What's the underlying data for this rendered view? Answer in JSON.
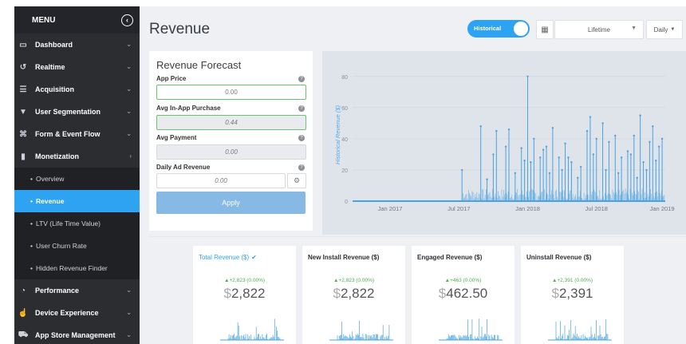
{
  "sidebar": {
    "menu_label": "MENU",
    "items": [
      {
        "label": "Dashboard",
        "icon": "monitor-icon"
      },
      {
        "label": "Realtime",
        "icon": "history-icon"
      },
      {
        "label": "Acquisition",
        "icon": "list-icon"
      },
      {
        "label": "User Segmentation",
        "icon": "funnel-icon"
      },
      {
        "label": "Form & Event Flow",
        "icon": "flow-icon"
      },
      {
        "label": "Monetization",
        "icon": "bar-chart-icon"
      }
    ],
    "sub_items": [
      {
        "label": "Overview"
      },
      {
        "label": "Revenue"
      },
      {
        "label": "LTV (Life Time Value)"
      },
      {
        "label": "User Churn Rate"
      },
      {
        "label": "Hidden Revenue Finder"
      }
    ],
    "bottom_items": [
      {
        "label": "Performance",
        "icon": "gauge-icon"
      },
      {
        "label": "Device Experience",
        "icon": "hand-icon"
      },
      {
        "label": "App Store Management",
        "icon": "cart-icon"
      }
    ]
  },
  "header": {
    "title": "Revenue",
    "toggle_label": "Historical",
    "range": "Lifetime",
    "period": "Daily"
  },
  "forecast": {
    "title": "Revenue Forecast",
    "fields": [
      {
        "label": "App Price",
        "value": "0.00"
      },
      {
        "label": "Avg In-App Purchase",
        "value": "0.44"
      },
      {
        "label": "Avg Payment",
        "value": "0.00"
      },
      {
        "label": "Daily Ad Revenue",
        "value": "0.00"
      }
    ],
    "apply_label": "Apply"
  },
  "chart_data": {
    "type": "bar",
    "ylabel": "Historical Revenue ($)",
    "y_ticks": [
      "80",
      "60",
      "40",
      "20",
      "0"
    ],
    "ylim": [
      0,
      85
    ],
    "x_ticks": [
      "Jan 2017",
      "Jul 2017",
      "Jan 2018",
      "Jul 2018",
      "Jan 2019"
    ],
    "x_tick_positions": [
      0.12,
      0.34,
      0.56,
      0.78,
      0.99
    ],
    "grid": true,
    "color": "#4aa3e0",
    "spikes": [
      {
        "x": 0.35,
        "y": 20
      },
      {
        "x": 0.41,
        "y": 48
      },
      {
        "x": 0.43,
        "y": 14
      },
      {
        "x": 0.45,
        "y": 30
      },
      {
        "x": 0.46,
        "y": 45
      },
      {
        "x": 0.49,
        "y": 35
      },
      {
        "x": 0.5,
        "y": 46
      },
      {
        "x": 0.52,
        "y": 18
      },
      {
        "x": 0.54,
        "y": 34
      },
      {
        "x": 0.55,
        "y": 26
      },
      {
        "x": 0.56,
        "y": 80
      },
      {
        "x": 0.57,
        "y": 25
      },
      {
        "x": 0.58,
        "y": 40
      },
      {
        "x": 0.6,
        "y": 28
      },
      {
        "x": 0.61,
        "y": 33
      },
      {
        "x": 0.62,
        "y": 35
      },
      {
        "x": 0.63,
        "y": 18
      },
      {
        "x": 0.64,
        "y": 47
      },
      {
        "x": 0.66,
        "y": 28
      },
      {
        "x": 0.67,
        "y": 20
      },
      {
        "x": 0.68,
        "y": 37
      },
      {
        "x": 0.69,
        "y": 28
      },
      {
        "x": 0.7,
        "y": 25
      },
      {
        "x": 0.72,
        "y": 15
      },
      {
        "x": 0.73,
        "y": 22
      },
      {
        "x": 0.75,
        "y": 45
      },
      {
        "x": 0.76,
        "y": 54
      },
      {
        "x": 0.77,
        "y": 30
      },
      {
        "x": 0.78,
        "y": 40
      },
      {
        "x": 0.8,
        "y": 50
      },
      {
        "x": 0.81,
        "y": 20
      },
      {
        "x": 0.82,
        "y": 38
      },
      {
        "x": 0.84,
        "y": 42
      },
      {
        "x": 0.85,
        "y": 18
      },
      {
        "x": 0.86,
        "y": 28
      },
      {
        "x": 0.88,
        "y": 32
      },
      {
        "x": 0.89,
        "y": 30
      },
      {
        "x": 0.9,
        "y": 42
      },
      {
        "x": 0.91,
        "y": 15
      },
      {
        "x": 0.92,
        "y": 55
      },
      {
        "x": 0.93,
        "y": 25
      },
      {
        "x": 0.94,
        "y": 20
      },
      {
        "x": 0.95,
        "y": 38
      },
      {
        "x": 0.96,
        "y": 48
      },
      {
        "x": 0.97,
        "y": 26
      },
      {
        "x": 0.98,
        "y": 35
      },
      {
        "x": 0.99,
        "y": 40
      }
    ]
  },
  "cards": [
    {
      "title": "Total Revenue ($)",
      "delta": "+2,823 (0.00%)",
      "currency": "$",
      "value": "2,822",
      "selected": true
    },
    {
      "title": "New Install Revenue ($)",
      "delta": "+2,823 (0.00%)",
      "currency": "$",
      "value": "2,822",
      "selected": false
    },
    {
      "title": "Engaged Revenue ($)",
      "delta": "+463 (0.00%)",
      "currency": "$",
      "value": "462.50",
      "selected": false
    },
    {
      "title": "Uninstall Revenue ($)",
      "delta": "+2,391 (0.00%)",
      "currency": "$",
      "value": "2,391",
      "selected": false
    }
  ]
}
